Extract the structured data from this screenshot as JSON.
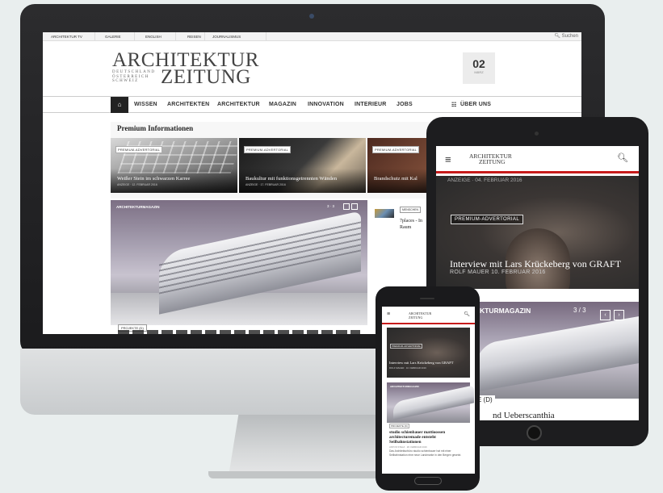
{
  "desktop": {
    "topbar_items": [
      "ARCHITEKTUR TV",
      "GALERIE",
      "ENGLISH",
      "REISEN",
      "JOURNALISMUS"
    ],
    "search_placeholder": "Suchen",
    "logo_line1": "ARCHITEKTUR",
    "logo_sub": "DEUTSCHLAND ÖSTERREICH SCHWEIZ",
    "logo_line2": "ZEITUNG",
    "date_day": "02",
    "date_month": "MÄRZ",
    "nav_items": [
      "WISSEN",
      "ARCHITEKTEN",
      "ARCHITEKTUR",
      "MAGAZIN",
      "INNOVATION",
      "INTERIEUR",
      "JOBS",
      "ÜBER UNS"
    ],
    "section_title": "Premium Informationen",
    "teasers": [
      {
        "badge": "PREMIUM-ADVERTORIAL",
        "title": "Weißer Stein im schwarzen Karree",
        "meta": "ANZEIGE · 12. FEBRUAR 2016"
      },
      {
        "badge": "PREMIUM-ADVERTORIAL",
        "title": "Baukultur mit funktionsgetrennten Wänden",
        "meta": "ANZEIGE · 17. FEBRUAR 2016"
      },
      {
        "badge": "PREMIUM-ADVERTORIAL",
        "title": "Brandschutz mit Kal",
        "meta": ""
      }
    ],
    "hero_label": "ARCHITEKTURMAGAZIN",
    "hero_pager": "3 · 3",
    "hero_tag": "PROJEKTE (D)",
    "side_tag": "MENSCHEN",
    "side_title": "7places - In Raum"
  },
  "tablet": {
    "logo_line1": "ARCHITEKTUR",
    "logo_line2": "ZEITUNG",
    "anzeige": "ANZEIGE · 04. FEBRUAR 2016",
    "badge": "PREMIUM-ADVERTORIAL",
    "article_title": "Interview mit Lars Krückeberg von GRAFT",
    "article_meta": "ROLF MAUER  10. FEBRUAR 2016",
    "hero_label": "KTURMAGAZIN",
    "pager": "3 / 3",
    "tag": "E (D)",
    "cut_title": "nd Ueberscanthia"
  },
  "phone": {
    "logo_line1": "ARCHITEKTUR",
    "logo_line2": "ZEITUNG",
    "badge": "PREMIUM-ADVERTORIAL",
    "article_title": "Interview mit Lars Krückeberg von GRAFT",
    "article_meta": "ROLF MAUER · 10. FEBRUAR 2016",
    "hero_label": "ARCHITEKTURMAGAZIN",
    "tag": "PROJEKTE (D)",
    "title": "studio schienbauer mattioossen architecturemade entsteht Seilbahnstationen",
    "meta": "ANTON STELZ · 28. FEBRUAR 2016",
    "text": "Das Architekturbüro studio schienbauer hat mit einer Seilbahnstation eine neue Landmarke in den Bergen gesetzt."
  }
}
